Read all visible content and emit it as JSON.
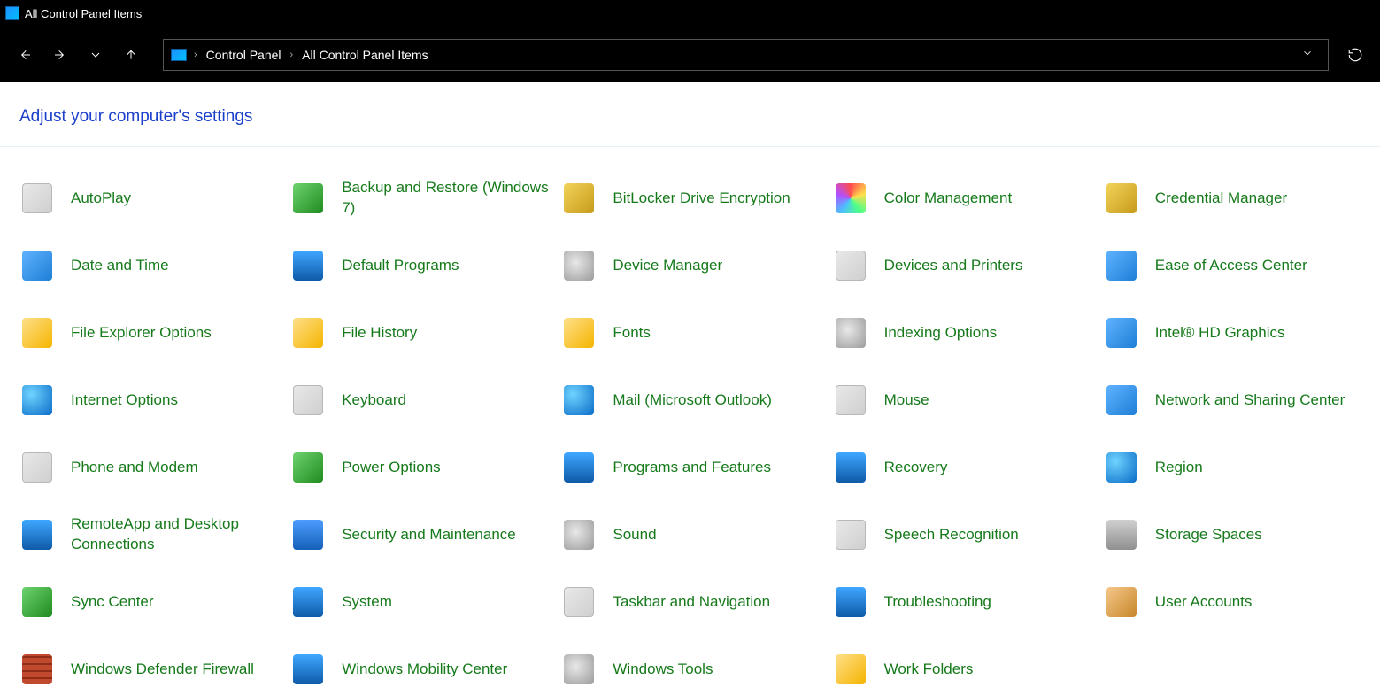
{
  "window": {
    "title": "All Control Panel Items"
  },
  "breadcrumb": {
    "items": [
      "Control Panel",
      "All Control Panel Items"
    ]
  },
  "heading": "Adjust your computer's settings",
  "items": [
    {
      "id": "autoplay",
      "label": "AutoPlay",
      "icon": "ic-square"
    },
    {
      "id": "backup-restore",
      "label": "Backup and Restore (Windows 7)",
      "icon": "ic-green"
    },
    {
      "id": "bitlocker",
      "label": "BitLocker Drive Encryption",
      "icon": "ic-key"
    },
    {
      "id": "color-management",
      "label": "Color Management",
      "icon": "ic-color"
    },
    {
      "id": "credential-manager",
      "label": "Credential Manager",
      "icon": "ic-key"
    },
    {
      "id": "date-time",
      "label": "Date and Time",
      "icon": "ic-blue"
    },
    {
      "id": "default-programs",
      "label": "Default Programs",
      "icon": "ic-screen"
    },
    {
      "id": "device-manager",
      "label": "Device Manager",
      "icon": "ic-gear"
    },
    {
      "id": "devices-printers",
      "label": "Devices and Printers",
      "icon": "ic-square"
    },
    {
      "id": "ease-of-access",
      "label": "Ease of Access Center",
      "icon": "ic-blue"
    },
    {
      "id": "file-explorer-opts",
      "label": "File Explorer Options",
      "icon": "ic-folder"
    },
    {
      "id": "file-history",
      "label": "File History",
      "icon": "ic-folder"
    },
    {
      "id": "fonts",
      "label": "Fonts",
      "icon": "ic-folder"
    },
    {
      "id": "indexing-options",
      "label": "Indexing Options",
      "icon": "ic-gear"
    },
    {
      "id": "intel-hd-graphics",
      "label": "Intel® HD Graphics",
      "icon": "ic-blue"
    },
    {
      "id": "internet-options",
      "label": "Internet Options",
      "icon": "ic-globe"
    },
    {
      "id": "keyboard",
      "label": "Keyboard",
      "icon": "ic-square"
    },
    {
      "id": "mail-outlook",
      "label": "Mail (Microsoft Outlook)",
      "icon": "ic-globe"
    },
    {
      "id": "mouse",
      "label": "Mouse",
      "icon": "ic-square"
    },
    {
      "id": "network-sharing",
      "label": "Network and Sharing Center",
      "icon": "ic-blue"
    },
    {
      "id": "phone-modem",
      "label": "Phone and Modem",
      "icon": "ic-square"
    },
    {
      "id": "power-options",
      "label": "Power Options",
      "icon": "ic-green"
    },
    {
      "id": "programs-features",
      "label": "Programs and Features",
      "icon": "ic-screen"
    },
    {
      "id": "recovery",
      "label": "Recovery",
      "icon": "ic-screen"
    },
    {
      "id": "region",
      "label": "Region",
      "icon": "ic-globe"
    },
    {
      "id": "remoteapp",
      "label": "RemoteApp and Desktop Connections",
      "icon": "ic-screen"
    },
    {
      "id": "security-maint",
      "label": "Security and Maintenance",
      "icon": "ic-shield"
    },
    {
      "id": "sound",
      "label": "Sound",
      "icon": "ic-gear"
    },
    {
      "id": "speech-recognition",
      "label": "Speech Recognition",
      "icon": "ic-square"
    },
    {
      "id": "storage-spaces",
      "label": "Storage Spaces",
      "icon": "ic-stack"
    },
    {
      "id": "sync-center",
      "label": "Sync Center",
      "icon": "ic-green"
    },
    {
      "id": "system",
      "label": "System",
      "icon": "ic-screen"
    },
    {
      "id": "taskbar-navigation",
      "label": "Taskbar and Navigation",
      "icon": "ic-square"
    },
    {
      "id": "troubleshooting",
      "label": "Troubleshooting",
      "icon": "ic-screen"
    },
    {
      "id": "user-accounts",
      "label": "User Accounts",
      "icon": "ic-people"
    },
    {
      "id": "defender-firewall",
      "label": "Windows Defender Firewall",
      "icon": "ic-wall"
    },
    {
      "id": "mobility-center",
      "label": "Windows Mobility Center",
      "icon": "ic-screen"
    },
    {
      "id": "windows-tools",
      "label": "Windows Tools",
      "icon": "ic-gear"
    },
    {
      "id": "work-folders",
      "label": "Work Folders",
      "icon": "ic-folder"
    }
  ]
}
